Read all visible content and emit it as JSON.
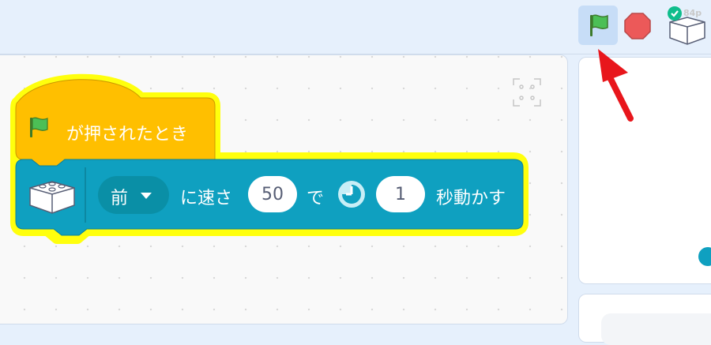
{
  "toolbar": {
    "go_icon": "green-flag-icon",
    "stop_icon": "stop-sign-icon",
    "device_icon": "lego-brick-icon",
    "device_status_icon": "check-icon",
    "device_label": "84p",
    "active_color": "#c7ddf7"
  },
  "blocks": {
    "hat": {
      "label": "が押されたとき",
      "color": "#ffbf00",
      "icon": "green-flag-icon"
    },
    "motion": {
      "color": "#0fa0c0",
      "icon": "lego-brick-icon",
      "direction": "前",
      "text_speed": "に速さ",
      "speed_value": "50",
      "text_for": "で",
      "time_icon": "clock-icon",
      "time_value": "1",
      "text_end": "秒動かす"
    },
    "highlight_color": "#ffff00"
  },
  "annotation": {
    "arrow_color": "#e8161c"
  }
}
